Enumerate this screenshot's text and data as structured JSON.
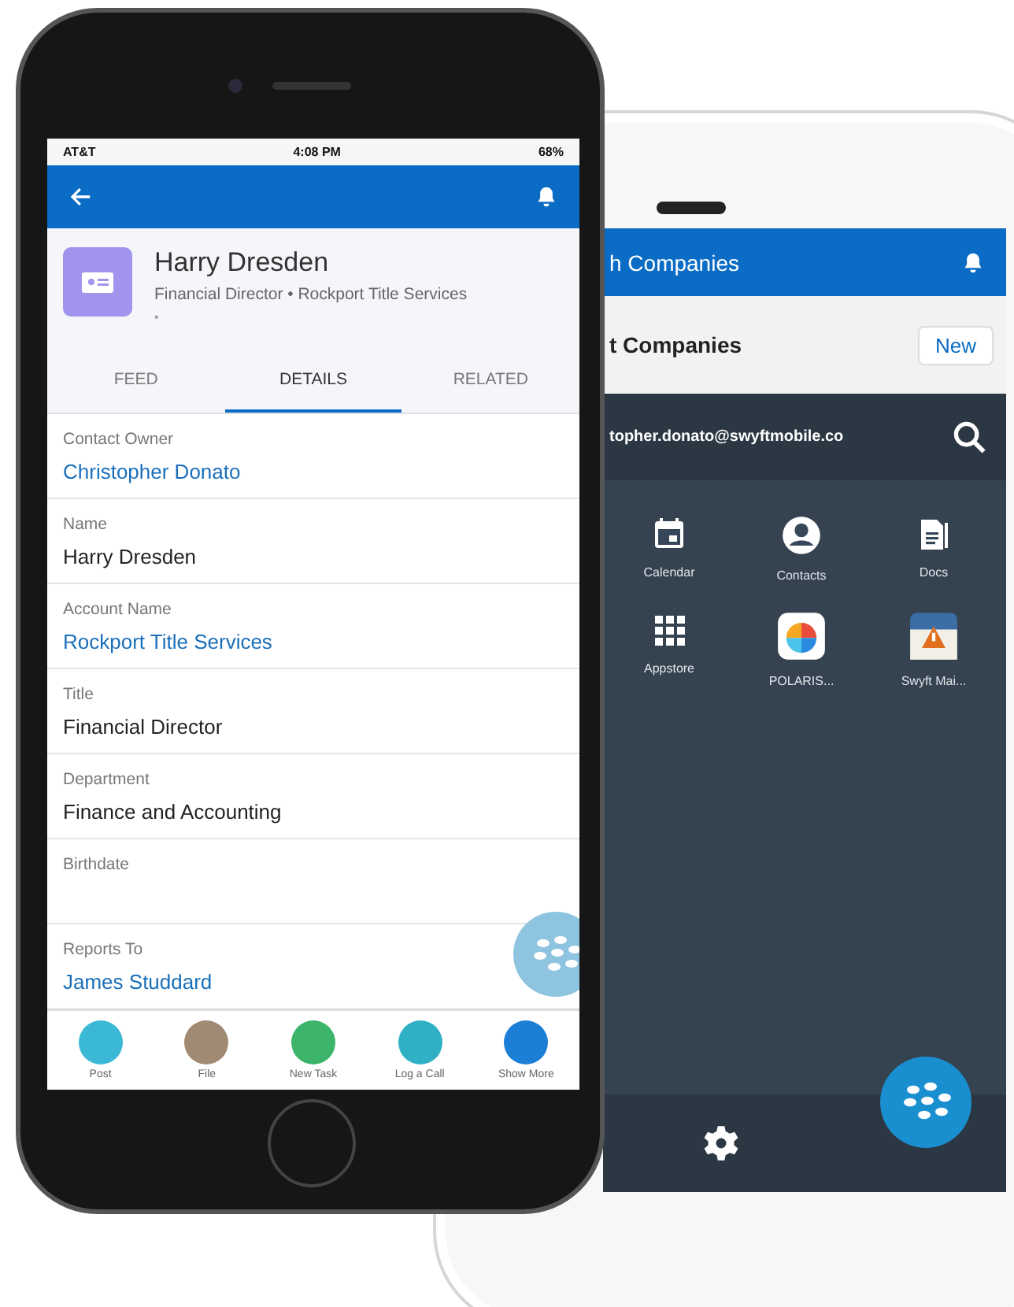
{
  "back_phone": {
    "title": "h Companies",
    "list_title": "t Companies",
    "new_button": "New",
    "account": "topher.donato@swyftmobile.co",
    "apps": [
      {
        "label": "Calendar",
        "kind": "calendar"
      },
      {
        "label": "Contacts",
        "kind": "contacts"
      },
      {
        "label": "Docs",
        "kind": "docs"
      },
      {
        "label": "Appstore",
        "kind": "grid"
      },
      {
        "label": "POLARIS...",
        "kind": "polaris"
      },
      {
        "label": "Swyft Mai...",
        "kind": "mail"
      }
    ]
  },
  "front_phone": {
    "status_bar": {
      "carrier": "AT&T",
      "time": "4:08 PM",
      "battery": "68%"
    },
    "record": {
      "name": "Harry Dresden",
      "subtitle": "Financial Director  •  Rockport Title Services",
      "more": "•"
    },
    "tabs": [
      {
        "label": "FEED",
        "selected": false
      },
      {
        "label": "DETAILS",
        "selected": true
      },
      {
        "label": "RELATED",
        "selected": false
      }
    ],
    "fields": [
      {
        "label": "Contact Owner",
        "value": "Christopher Donato",
        "kind": "link"
      },
      {
        "label": "Name",
        "value": "Harry Dresden",
        "kind": "text"
      },
      {
        "label": "Account Name",
        "value": "Rockport Title Services",
        "kind": "link"
      },
      {
        "label": "Title",
        "value": "Financial Director",
        "kind": "text"
      },
      {
        "label": "Department",
        "value": "Finance and Accounting",
        "kind": "text"
      },
      {
        "label": "Birthdate"
      },
      {
        "label": "Reports To",
        "value": "James Studdard",
        "kind": "link"
      }
    ],
    "actions": [
      {
        "label": "Post",
        "color": "#3bb8d6"
      },
      {
        "label": "File",
        "color": "#a08a74"
      },
      {
        "label": "New Task",
        "color": "#3cb56a"
      },
      {
        "label": "Log a Call",
        "color": "#2fb0c4"
      },
      {
        "label": "Show More",
        "color": "#1b7fd6"
      }
    ]
  }
}
